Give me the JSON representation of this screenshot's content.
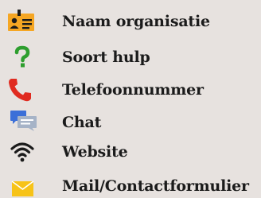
{
  "legend": {
    "items": [
      {
        "label": "Naam organisatie",
        "icon": "id-badge-icon",
        "color": "#f5a623"
      },
      {
        "label": "Soort hulp",
        "icon": "question-mark-icon",
        "color": "#2e9e2e"
      },
      {
        "label": "Telefoonnummer",
        "icon": "phone-icon",
        "color": "#e02b20"
      },
      {
        "label": "Chat",
        "icon": "chat-bubbles-icon",
        "color": "#3b6fd8"
      },
      {
        "label": "Website",
        "icon": "wifi-icon",
        "color": "#1b1b1b"
      },
      {
        "label": "Mail/Contactformulier",
        "icon": "envelope-icon",
        "color": "#f7c318"
      }
    ]
  }
}
